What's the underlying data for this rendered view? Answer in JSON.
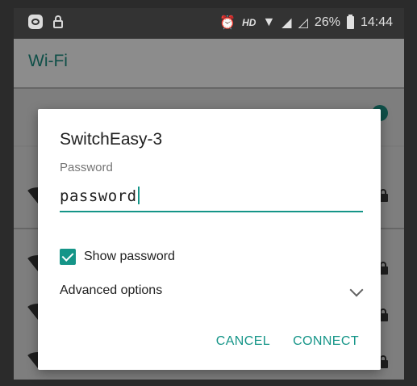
{
  "statusbar": {
    "hd_label": "HD",
    "battery": "26%",
    "time": "14:44",
    "icons": [
      "app-notification-icon",
      "lock-icon",
      "alarm-icon",
      "wifi-icon",
      "signal-icon",
      "no-signal-icon",
      "battery-icon"
    ]
  },
  "appbar": {
    "title": "Wi-Fi"
  },
  "dialog": {
    "title": "SwitchEasy-3",
    "password_label": "Password",
    "password_value": "password",
    "show_password_label": "Show password",
    "show_password_checked": true,
    "advanced_options_label": "Advanced options",
    "cancel_label": "CANCEL",
    "connect_label": "CONNECT"
  },
  "colors": {
    "accent": "#159588",
    "title_text": "#212121",
    "secondary_text": "#757575"
  }
}
